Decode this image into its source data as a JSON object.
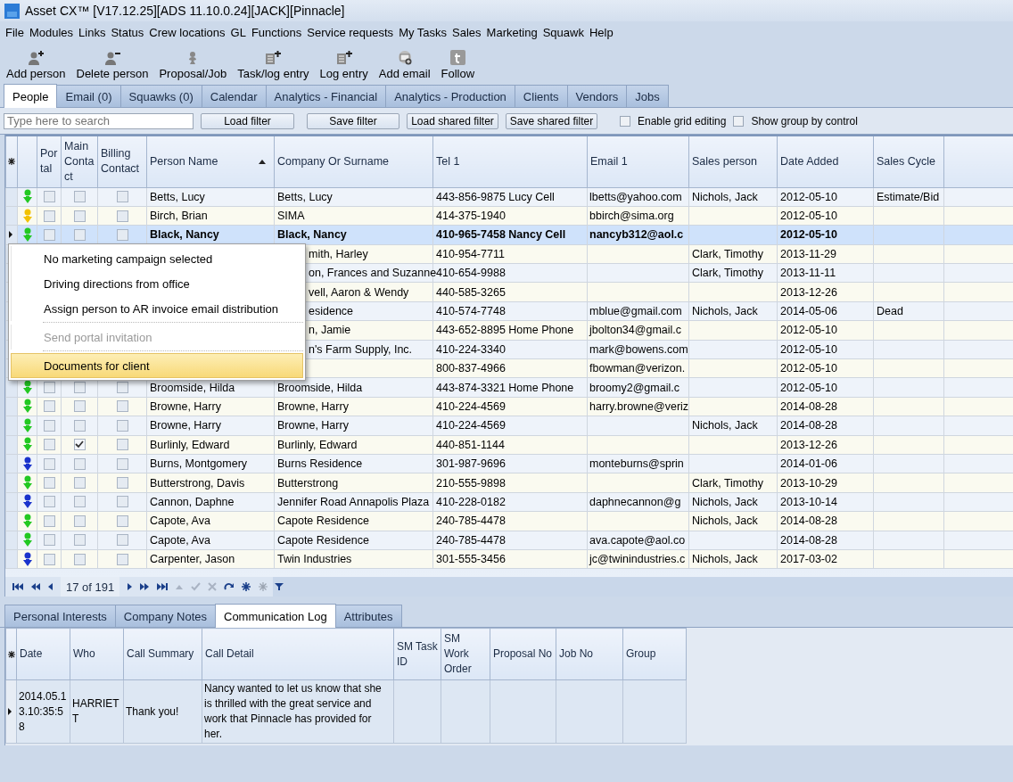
{
  "window": {
    "title": "Asset CX™ [V17.12.25][ADS 11.10.0.24][JACK][Pinnacle]"
  },
  "menu": [
    "File",
    "Modules",
    "Links",
    "Status",
    "Crew locations",
    "GL",
    "Functions",
    "Service requests",
    "My Tasks",
    "Sales",
    "Marketing",
    "Squawk",
    "Help"
  ],
  "toolbar": [
    {
      "label": "Add person",
      "kind": "add-person"
    },
    {
      "label": "Delete person",
      "kind": "delete-person"
    },
    {
      "label": "Proposal/Job",
      "kind": "person"
    },
    {
      "label": "Task/log entry",
      "kind": "list-add"
    },
    {
      "label": "Log entry",
      "kind": "list-add"
    },
    {
      "label": "Add email",
      "kind": "email"
    },
    {
      "label": "Follow",
      "kind": "follow"
    }
  ],
  "tabs": [
    {
      "label": "People",
      "selected": true
    },
    {
      "label": "Email (0)",
      "selected": false
    },
    {
      "label": "Squawks (0)",
      "selected": false
    },
    {
      "label": "Calendar",
      "selected": false
    },
    {
      "label": "Analytics - Financial",
      "selected": false
    },
    {
      "label": "Analytics - Production",
      "selected": false
    },
    {
      "label": "Clients",
      "selected": false
    },
    {
      "label": "Vendors",
      "selected": false
    },
    {
      "label": "Jobs",
      "selected": false
    }
  ],
  "filter": {
    "search": {
      "placeholder": "Type here to search"
    },
    "buttons": [
      "Load filter",
      "Save filter",
      "Load shared filter",
      "Save shared filter"
    ],
    "options": [
      {
        "label": "Enable grid editing",
        "checked": false
      },
      {
        "label": "Show group by control",
        "checked": false
      }
    ]
  },
  "grid": {
    "columns": [
      {
        "label": "Portal",
        "sorted": false
      },
      {
        "label": "Main Contact",
        "sorted": false
      },
      {
        "label": "Billing Contact",
        "sorted": false
      },
      {
        "label": "Person Name",
        "sorted": true
      },
      {
        "label": "Company Or Surname",
        "sorted": false
      },
      {
        "label": "Tel 1",
        "sorted": false
      },
      {
        "label": "Email 1",
        "sorted": false
      },
      {
        "label": "Sales person",
        "sorted": false
      },
      {
        "label": "Date Added",
        "sorted": false
      },
      {
        "label": "Sales Cycle",
        "sorted": false
      }
    ],
    "rows": [
      {
        "kind": "full",
        "selected": false,
        "color": "#22c822",
        "portal": false,
        "main_contact": false,
        "billing_contact": false,
        "name": "Betts, Lucy",
        "company": "Betts, Lucy",
        "tel": "443-856-9875 Lucy Cell",
        "email": "lbetts@yahoo.com",
        "sales_person": "Nichols, Jack",
        "date_added": "2012-05-10",
        "sales_cycle": "Estimate/Bid"
      },
      {
        "kind": "full",
        "selected": false,
        "color": "#f2c200",
        "portal": false,
        "main_contact": false,
        "billing_contact": false,
        "name": "Birch, Brian",
        "company": "SIMA",
        "tel": "414-375-1940",
        "email": "bbirch@sima.org",
        "date_added": "2012-05-10"
      },
      {
        "kind": "full",
        "selected": true,
        "color": "#22c822",
        "portal": false,
        "main_contact": false,
        "billing_contact": false,
        "name": "Black, Nancy",
        "company": "Black, Nancy",
        "tel": "410-965-7458 Nancy Cell",
        "email": "nancyb312@aol.c",
        "date_added": "2012-05-10"
      },
      {
        "kind": "covered",
        "company": "mith, Harley",
        "tel": "410-954-7711",
        "sales_person": "Clark, Timothy",
        "date_added": "2013-11-29"
      },
      {
        "kind": "covered",
        "company": "on, Frances and Suzanne",
        "tel": "410-654-9988",
        "sales_person": "Clark, Timothy",
        "date_added": "2013-11-11"
      },
      {
        "kind": "covered",
        "company": "vell, Aaron & Wendy",
        "tel": "440-585-3265",
        "date_added": "2013-12-26"
      },
      {
        "kind": "covered",
        "company": "esidence",
        "tel": "410-574-7748",
        "email": "mblue@gmail.com",
        "sales_person": "Nichols, Jack",
        "date_added": "2014-05-06",
        "sales_cycle": "Dead"
      },
      {
        "kind": "covered",
        "company": "n, Jamie",
        "tel": "443-652-8895 Home Phone",
        "email": "jbolton34@gmail.c",
        "date_added": "2012-05-10"
      },
      {
        "kind": "covered",
        "company": "n's Farm Supply, Inc.",
        "tel": "410-224-3340",
        "email": "mark@bowens.com",
        "date_added": "2012-05-10"
      },
      {
        "kind": "covered",
        "tel": "800-837-4966",
        "email": "fbowman@verizon.",
        "date_added": "2012-05-10"
      },
      {
        "kind": "full",
        "selected": false,
        "color": "#22c822",
        "portal": false,
        "main_contact": false,
        "billing_contact": false,
        "name": "Broomside, Hilda",
        "company": "Broomside, Hilda",
        "tel": "443-874-3321 Home Phone",
        "email": "broomy2@gmail.c",
        "date_added": "2012-05-10"
      },
      {
        "kind": "full",
        "selected": false,
        "color": "#22c822",
        "portal": false,
        "main_contact": false,
        "billing_contact": false,
        "name": "Browne, Harry",
        "company": "Browne, Harry",
        "tel": "410-224-4569",
        "email": "harry.browne@veriz",
        "date_added": "2014-08-28"
      },
      {
        "kind": "full",
        "selected": false,
        "color": "#22c822",
        "portal": false,
        "main_contact": false,
        "billing_contact": false,
        "name": "Browne, Harry",
        "company": "Browne, Harry",
        "tel": "410-224-4569",
        "sales_person": "Nichols, Jack",
        "date_added": "2014-08-28"
      },
      {
        "kind": "full",
        "selected": false,
        "color": "#22c822",
        "portal": false,
        "main_contact": true,
        "billing_contact": false,
        "name": "Burlinly, Edward",
        "company": "Burlinly, Edward",
        "tel": "440-851-1144",
        "date_added": "2013-12-26"
      },
      {
        "kind": "full",
        "selected": false,
        "color": "#1a33cc",
        "portal": false,
        "main_contact": false,
        "billing_contact": false,
        "name": "Burns, Montgomery",
        "company": "Burns Residence",
        "tel": "301-987-9696",
        "email": "monteburns@sprin",
        "date_added": "2014-01-06"
      },
      {
        "kind": "full",
        "selected": false,
        "color": "#22c822",
        "portal": false,
        "main_contact": false,
        "billing_contact": false,
        "name": "Butterstrong, Davis",
        "company": "Butterstrong",
        "tel": "210-555-9898",
        "sales_person": "Clark, Timothy",
        "date_added": "2013-10-29"
      },
      {
        "kind": "full",
        "selected": false,
        "color": "#1a33cc",
        "portal": false,
        "main_contact": false,
        "billing_contact": false,
        "name": "Cannon, Daphne",
        "company": "Jennifer Road Annapolis Plaza",
        "tel": "410-228-0182",
        "email": "daphnecannon@g",
        "sales_person": "Nichols, Jack",
        "date_added": "2013-10-14"
      },
      {
        "kind": "full",
        "selected": false,
        "color": "#22c822",
        "portal": false,
        "main_contact": false,
        "billing_contact": false,
        "name": "Capote, Ava",
        "company": "Capote Residence",
        "tel": "240-785-4478",
        "sales_person": "Nichols, Jack",
        "date_added": "2014-08-28"
      },
      {
        "kind": "full",
        "selected": false,
        "color": "#22c822",
        "portal": false,
        "main_contact": false,
        "billing_contact": false,
        "name": "Capote, Ava",
        "company": "Capote Residence",
        "tel": "240-785-4478",
        "email": "ava.capote@aol.co",
        "date_added": "2014-08-28"
      },
      {
        "kind": "full",
        "selected": false,
        "color": "#1a33cc",
        "portal": false,
        "main_contact": false,
        "billing_contact": false,
        "name": "Carpenter, Jason",
        "company": "Twin Industries",
        "tel": "301-555-3456",
        "email": "jc@twinindustries.c",
        "sales_person": "Nichols, Jack",
        "date_added": "2017-03-02"
      }
    ]
  },
  "context_menu": [
    {
      "kind": "item",
      "label": "No marketing campaign selected",
      "disabled": false,
      "selected": false
    },
    {
      "kind": "item",
      "label": "Driving directions from office",
      "disabled": false,
      "selected": false
    },
    {
      "kind": "item",
      "label": "Assign person to AR invoice email distribution",
      "disabled": false,
      "selected": false
    },
    {
      "kind": "separator"
    },
    {
      "kind": "item",
      "label": "Send portal invitation",
      "disabled": true,
      "selected": false
    },
    {
      "kind": "separator"
    },
    {
      "kind": "item",
      "label": "Documents for client",
      "disabled": false,
      "selected": true
    }
  ],
  "navigator": {
    "position": "17 of 191"
  },
  "detail_tabs": [
    {
      "label": "Personal Interests",
      "selected": false
    },
    {
      "label": "Company Notes",
      "selected": false
    },
    {
      "label": "Communication Log",
      "selected": true
    },
    {
      "label": "Attributes",
      "selected": false
    }
  ],
  "log": {
    "columns": [
      "Date",
      "Who",
      "Call Summary",
      "Call Detail",
      "SM Task ID",
      "SM Work Order",
      "Proposal No",
      "Job No",
      "Group"
    ],
    "rows": [
      {
        "selected": true,
        "date": "2014.05.13.10:35:58",
        "who": "HARRIETT",
        "summary": "Thank you!",
        "detail": "Nancy wanted to let us know that she is thrilled with the great service and work that Pinnacle has provided for her."
      }
    ]
  }
}
